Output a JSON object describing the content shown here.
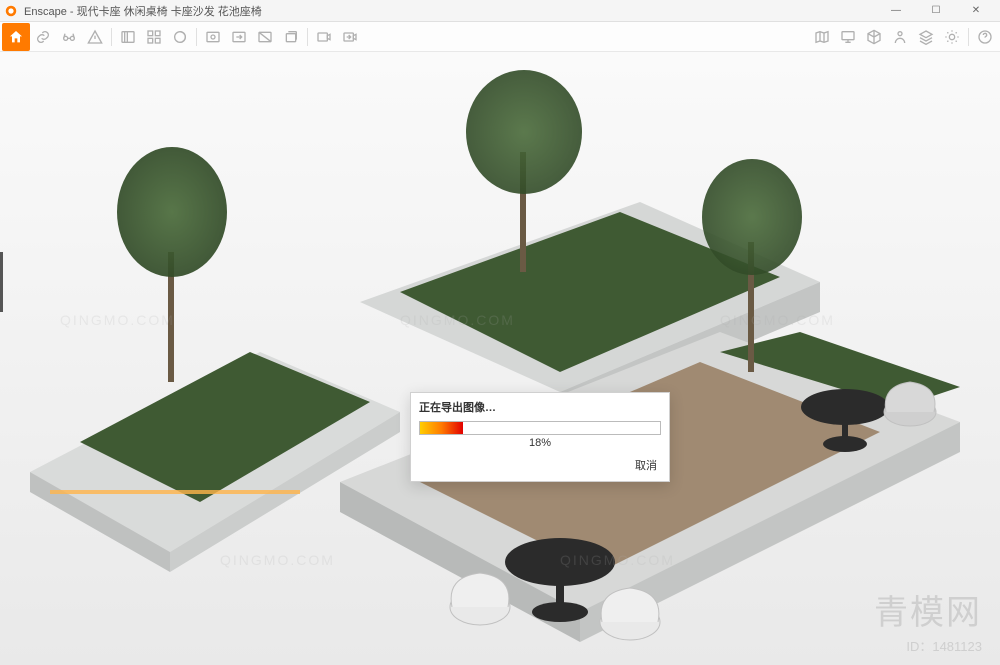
{
  "window": {
    "title": "Enscape - 现代卡座 休闲桌椅 卡座沙发 花池座椅",
    "controls": {
      "minimize": "—",
      "maximize": "☐",
      "close": "✕"
    }
  },
  "toolbar": {
    "icons": [
      "home",
      "link",
      "glasses",
      "warning",
      "separator",
      "library",
      "assets",
      "material",
      "separator",
      "screenshot",
      "export",
      "mono",
      "batch",
      "separator",
      "video",
      "video-export"
    ],
    "right_icons": [
      "map",
      "screen",
      "cube",
      "person",
      "layers",
      "sun",
      "help"
    ]
  },
  "dialog": {
    "title": "正在导出图像…",
    "percent": 18,
    "percent_label": "18%",
    "cancel": "取消"
  },
  "watermark": {
    "text": "QINGMO.COM"
  },
  "brand": {
    "zh": "青模网",
    "id_label": "ID：1481123"
  },
  "colors": {
    "accent": "#ff7a00",
    "progress_start": "#ffce00",
    "progress_end": "#e20000"
  }
}
